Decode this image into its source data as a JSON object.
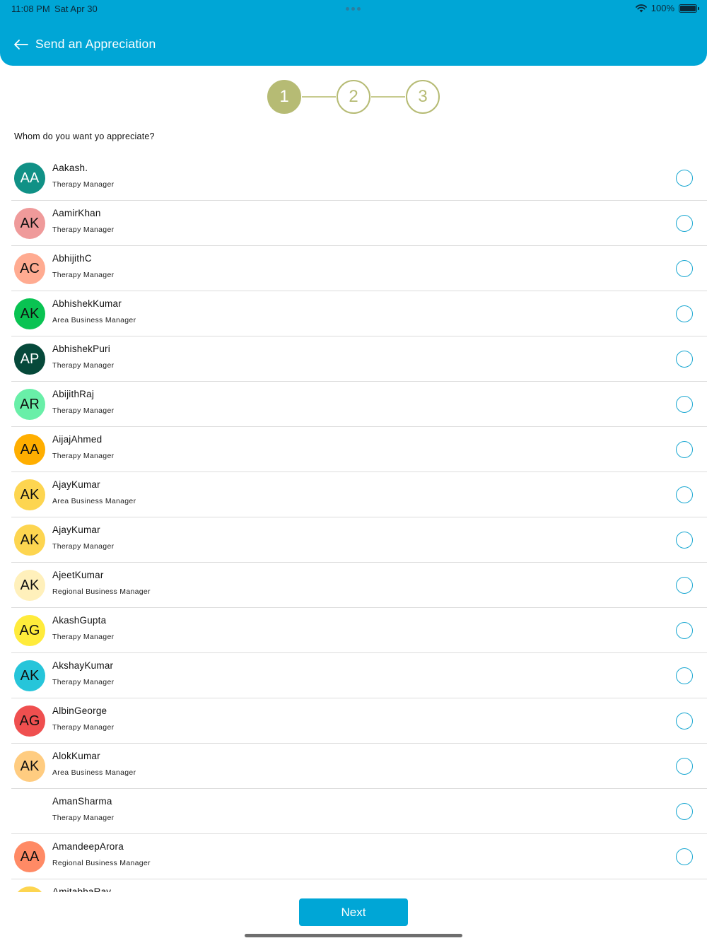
{
  "status_bar": {
    "time": "11:08 PM",
    "date": "Sat Apr 30",
    "battery": "100%"
  },
  "header": {
    "title": "Send an Appreciation"
  },
  "stepper": {
    "steps": [
      "1",
      "2",
      "3"
    ],
    "active": 1
  },
  "question": "Whom do you want yo appreciate?",
  "people": [
    {
      "initials": "AA",
      "name": "Aakash.",
      "role": "Therapy Manager",
      "color": "#109186",
      "text_color": "#ffffff"
    },
    {
      "initials": "AK",
      "name": "AamirKhan",
      "role": "Therapy Manager",
      "color": "#ef9a9a",
      "text_color": "#111111"
    },
    {
      "initials": "AC",
      "name": "AbhijithC",
      "role": "Therapy Manager",
      "color": "#ffab91",
      "text_color": "#111111"
    },
    {
      "initials": "AK",
      "name": "AbhishekKumar",
      "role": "Area Business Manager",
      "color": "#09c352",
      "text_color": "#111111"
    },
    {
      "initials": "AP",
      "name": "AbhishekPuri",
      "role": "Therapy Manager",
      "color": "#06493a",
      "text_color": "#ffffff"
    },
    {
      "initials": "AR",
      "name": "AbijithRaj",
      "role": "Therapy Manager",
      "color": "#69efa8",
      "text_color": "#111111"
    },
    {
      "initials": "AA",
      "name": "AijajAhmed",
      "role": "Therapy Manager",
      "color": "#ffae00",
      "text_color": "#111111"
    },
    {
      "initials": "AK",
      "name": "AjayKumar",
      "role": "Area Business Manager",
      "color": "#fdd550",
      "text_color": "#111111"
    },
    {
      "initials": "AK",
      "name": "AjayKumar",
      "role": "Therapy Manager",
      "color": "#fdd550",
      "text_color": "#111111"
    },
    {
      "initials": "AK",
      "name": "AjeetKumar",
      "role": "Regional Business Manager",
      "color": "#fff0bb",
      "text_color": "#111111"
    },
    {
      "initials": "AG",
      "name": "AkashGupta",
      "role": "Therapy Manager",
      "color": "#ffeb3b",
      "text_color": "#111111"
    },
    {
      "initials": "AK",
      "name": "AkshayKumar",
      "role": "Therapy Manager",
      "color": "#26c5da",
      "text_color": "#111111"
    },
    {
      "initials": "AG",
      "name": "AlbinGeorge",
      "role": "Therapy Manager",
      "color": "#ef4f4f",
      "text_color": "#111111"
    },
    {
      "initials": "AK",
      "name": "AlokKumar",
      "role": "Area Business Manager",
      "color": "#ffcc80",
      "text_color": "#111111"
    },
    {
      "initials": "",
      "name": "AmanSharma",
      "role": "Therapy Manager",
      "color": "#ffffff",
      "text_color": "#111111"
    },
    {
      "initials": "AA",
      "name": "AmandeepArora",
      "role": "Regional Business Manager",
      "color": "#ff8a65",
      "text_color": "#111111"
    },
    {
      "initials": "",
      "name": "AmitabhaRay",
      "role": "",
      "color": "#fdd550",
      "text_color": "#111111"
    }
  ],
  "actions": {
    "next_label": "Next"
  }
}
